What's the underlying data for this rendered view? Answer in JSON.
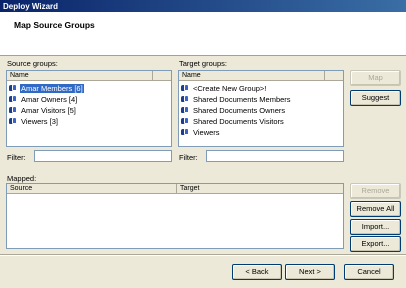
{
  "window": {
    "title": "Deploy Wizard"
  },
  "header": {
    "title": "Map Source Groups"
  },
  "source_groups": {
    "label": "Source groups:",
    "column_name": "Name",
    "items": [
      "Amar Members [6]",
      "Amar Owners [4]",
      "Amar Visitors [5]",
      "Viewers [3]"
    ],
    "selected_index": 0,
    "filter_label": "Filter:",
    "filter_value": ""
  },
  "target_groups": {
    "label": "Target groups:",
    "column_name": "Name",
    "items": [
      "<Create New Group>!",
      "Shared Documents Members",
      "Shared Documents Owners",
      "Shared Documents Visitors",
      "Viewers"
    ],
    "filter_label": "Filter:",
    "filter_value": ""
  },
  "mapped": {
    "label": "Mapped:",
    "columns": [
      "Source",
      "Target"
    ]
  },
  "buttons": {
    "map": "Map",
    "suggest": "Suggest",
    "remove": "Remove",
    "remove_all": "Remove All",
    "import": "Import...",
    "export": "Export...",
    "back": "< Back",
    "next": "Next >",
    "cancel": "Cancel"
  }
}
